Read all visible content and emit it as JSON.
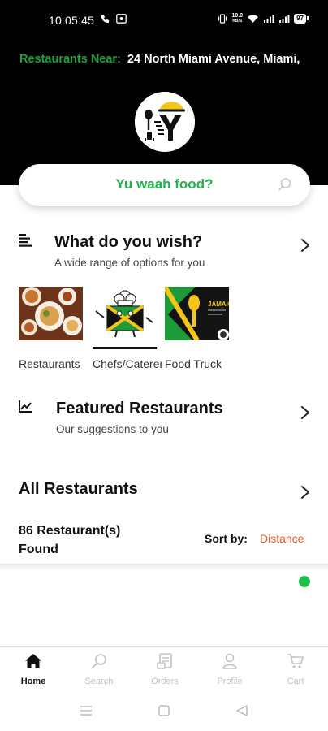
{
  "status_bar": {
    "time": "10:05:45",
    "network_speed_top": "10.0",
    "network_speed_bottom": "KB/S",
    "battery": "97"
  },
  "header": {
    "near_label": "Restaurants Near:",
    "address": "24 North Miami Avenue, Miami,"
  },
  "search": {
    "prompt": "Yu waah food?"
  },
  "wish_section": {
    "title": "What do you wish?",
    "subtitle": "A wide range of options for you"
  },
  "categories": [
    {
      "label": "Restaurants",
      "selected": false
    },
    {
      "label": "Chefs/Caterers",
      "selected": true
    },
    {
      "label": "Food Truck",
      "selected": false
    }
  ],
  "featured_section": {
    "title": "Featured Restaurants",
    "subtitle": "Our suggestions to you"
  },
  "all_section": {
    "title": "All Restaurants",
    "found_count": "86 Restaurant(s)",
    "found_word": "Found",
    "sort_label": "Sort by:",
    "sort_value": "Distance"
  },
  "food_truck_card": {
    "banner_text": "JAMAICA"
  },
  "bottom_nav": [
    {
      "label": "Home",
      "icon": "home-icon",
      "active": true
    },
    {
      "label": "Search",
      "icon": "search-icon",
      "active": false
    },
    {
      "label": "Orders",
      "icon": "orders-icon",
      "active": false
    },
    {
      "label": "Profile",
      "icon": "profile-icon",
      "active": false
    },
    {
      "label": "Cart",
      "icon": "cart-icon",
      "active": false
    }
  ],
  "colors": {
    "brand_green": "#22b14c",
    "accent_orange": "#e0592a",
    "online_dot": "#22c04b",
    "header_bg": "#000000"
  }
}
